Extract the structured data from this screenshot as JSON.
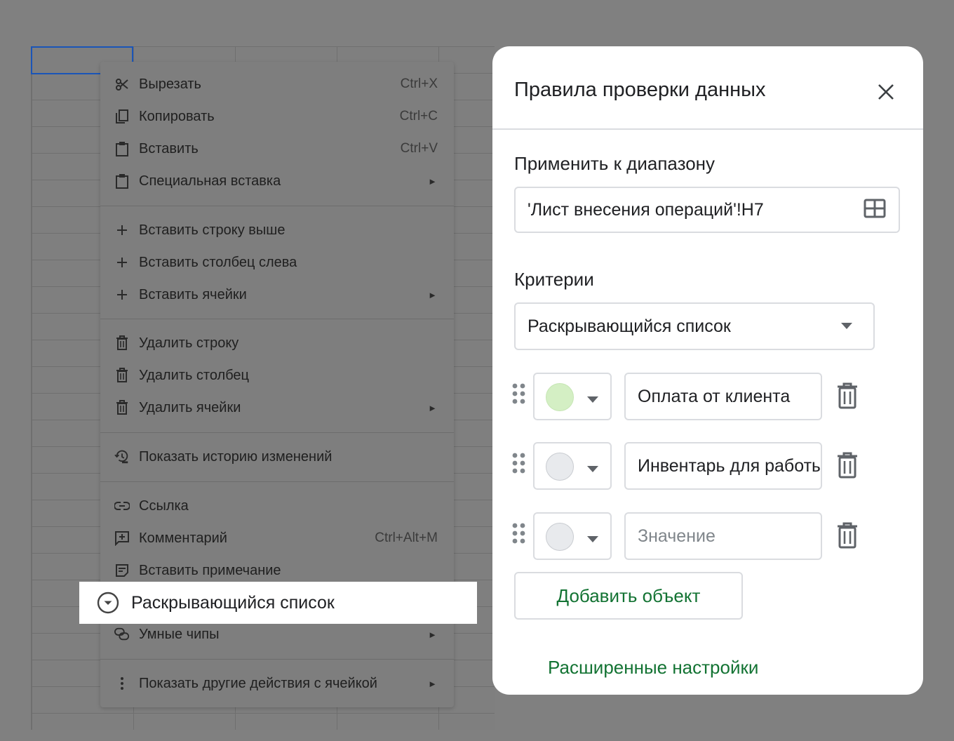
{
  "context_menu": {
    "items": [
      {
        "label": "Вырезать",
        "shortcut": "Ctrl+X",
        "icon": "scissors-icon"
      },
      {
        "label": "Копировать",
        "shortcut": "Ctrl+C",
        "icon": "copy-icon"
      },
      {
        "label": "Вставить",
        "shortcut": "Ctrl+V",
        "icon": "clipboard-icon"
      },
      {
        "label": "Специальная вставка",
        "arrow": "►",
        "icon": "clipboard-icon"
      },
      {
        "label": "Вставить строку выше",
        "icon": "plus-icon"
      },
      {
        "label": "Вставить столбец слева",
        "icon": "plus-icon"
      },
      {
        "label": "Вставить ячейки",
        "arrow": "►",
        "icon": "plus-icon"
      },
      {
        "label": "Удалить строку",
        "icon": "trash-icon"
      },
      {
        "label": "Удалить столбец",
        "icon": "trash-icon"
      },
      {
        "label": "Удалить ячейки",
        "arrow": "►",
        "icon": "trash-icon"
      },
      {
        "label": "Показать историю изменений",
        "icon": "history-icon"
      },
      {
        "label": "Ссылка",
        "icon": "link-icon"
      },
      {
        "label": "Комментарий",
        "shortcut": "Ctrl+Alt+M",
        "icon": "comment-add-icon"
      },
      {
        "label": "Вставить примечание",
        "icon": "note-icon"
      },
      {
        "label": "Умные чипы",
        "arrow": "►",
        "icon": "smart-chip-icon"
      },
      {
        "label": "Показать другие действия с ячейкой",
        "arrow": "►",
        "icon": "more-vert-icon"
      }
    ],
    "highlighted_item": {
      "label": "Раскрывающийся список",
      "icon": "dropdown-circle-icon"
    }
  },
  "panel": {
    "title": "Правила проверки данных",
    "range_label": "Применить к диапазону",
    "range_value": "'Лист внесения операций'!H7",
    "criteria_label": "Критерии",
    "criteria_value": "Раскрывающийся список",
    "options": [
      {
        "value": "Оплата от клиента",
        "color": "#d4efc4"
      },
      {
        "value": "Инвентарь для работы",
        "color": "#e8eaed"
      },
      {
        "value": "",
        "placeholder": "Значение",
        "color": "#e8eaed"
      }
    ],
    "add_button": "Добавить объект",
    "advanced_link": "Расширенные настройки"
  }
}
